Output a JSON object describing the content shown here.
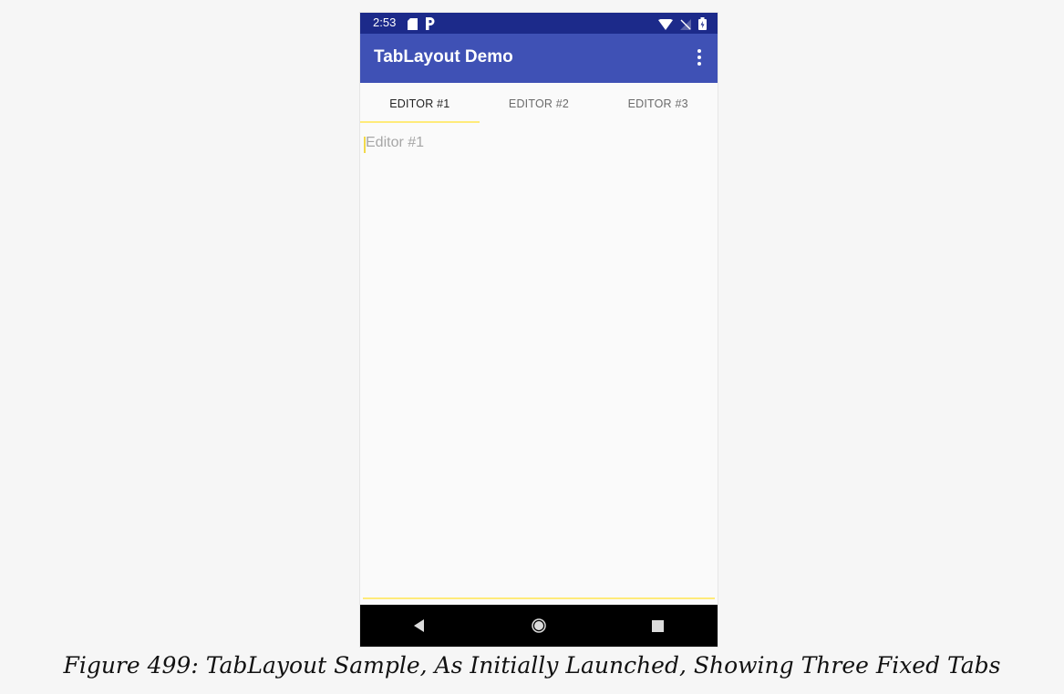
{
  "status_bar": {
    "time": "2:53",
    "left_icons": [
      "sd-card-icon",
      "parking-icon"
    ],
    "right_icons": [
      "wifi-icon",
      "no-signal-icon",
      "battery-icon"
    ]
  },
  "app_bar": {
    "title": "TabLayout Demo",
    "overflow_icon": "more-vertical-icon"
  },
  "tabs": [
    {
      "label": "EDITOR #1",
      "selected": true
    },
    {
      "label": "EDITOR #2",
      "selected": false
    },
    {
      "label": "EDITOR #3",
      "selected": false
    }
  ],
  "editor": {
    "placeholder": "Editor #1",
    "value": ""
  },
  "nav_bar": {
    "buttons": [
      "back-icon",
      "home-icon",
      "recents-icon"
    ]
  },
  "caption": "Figure 499: TabLayout Sample, As Initially Launched, Showing Three Fixed Tabs",
  "colors": {
    "status_bar": "#1c2a8a",
    "app_bar": "#3f51b5",
    "tab_indicator": "#ffeb7a",
    "nav_bar": "#000000"
  }
}
